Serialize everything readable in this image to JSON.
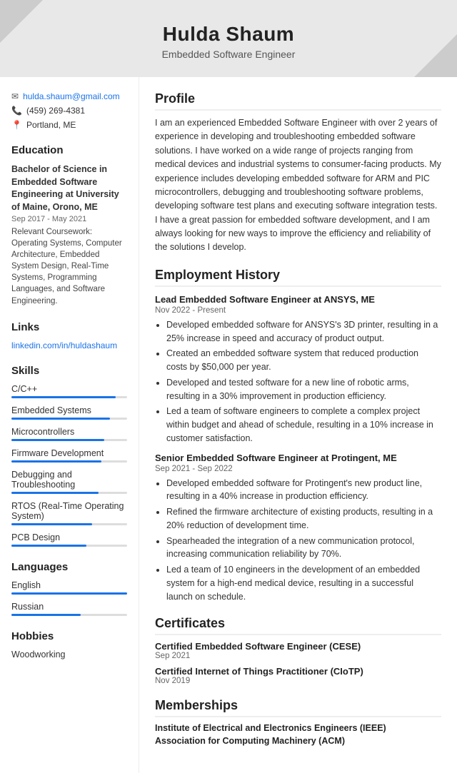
{
  "header": {
    "name": "Hulda Shaum",
    "title": "Embedded Software Engineer"
  },
  "sidebar": {
    "contact": {
      "email": "hulda.shaum@gmail.com",
      "phone": "(459) 269-4381",
      "location": "Portland, ME"
    },
    "education": {
      "section_title": "Education",
      "degree": "Bachelor of Science in Embedded Software Engineering at University of Maine, Orono, ME",
      "date": "Sep 2017 - May 2021",
      "coursework_label": "Relevant Coursework:",
      "coursework": "Operating Systems, Computer Architecture, Embedded System Design, Real-Time Systems, Programming Languages, and Software Engineering."
    },
    "links": {
      "section_title": "Links",
      "items": [
        {
          "label": "linkedin.com/in/huldashaum",
          "url": "#"
        }
      ]
    },
    "skills": {
      "section_title": "Skills",
      "items": [
        {
          "name": "C/C++",
          "percent": 90
        },
        {
          "name": "Embedded Systems",
          "percent": 85
        },
        {
          "name": "Microcontrollers",
          "percent": 80
        },
        {
          "name": "Firmware Development",
          "percent": 78
        },
        {
          "name": "Debugging and Troubleshooting",
          "percent": 75
        },
        {
          "name": "RTOS (Real-Time Operating System)",
          "percent": 70
        },
        {
          "name": "PCB Design",
          "percent": 65
        }
      ]
    },
    "languages": {
      "section_title": "Languages",
      "items": [
        {
          "name": "English",
          "percent": 100
        },
        {
          "name": "Russian",
          "percent": 60
        }
      ]
    },
    "hobbies": {
      "section_title": "Hobbies",
      "items": [
        {
          "name": "Woodworking"
        }
      ]
    }
  },
  "content": {
    "profile": {
      "section_title": "Profile",
      "text": "I am an experienced Embedded Software Engineer with over 2 years of experience in developing and troubleshooting embedded software solutions. I have worked on a wide range of projects ranging from medical devices and industrial systems to consumer-facing products. My experience includes developing embedded software for ARM and PIC microcontrollers, debugging and troubleshooting software problems, developing software test plans and executing software integration tests. I have a great passion for embedded software development, and I am always looking for new ways to improve the efficiency and reliability of the solutions I develop."
    },
    "employment": {
      "section_title": "Employment History",
      "jobs": [
        {
          "title": "Lead Embedded Software Engineer at ANSYS, ME",
          "date": "Nov 2022 - Present",
          "bullets": [
            "Developed embedded software for ANSYS's 3D printer, resulting in a 25% increase in speed and accuracy of product output.",
            "Created an embedded software system that reduced production costs by $50,000 per year.",
            "Developed and tested software for a new line of robotic arms, resulting in a 30% improvement in production efficiency.",
            "Led a team of software engineers to complete a complex project within budget and ahead of schedule, resulting in a 10% increase in customer satisfaction."
          ]
        },
        {
          "title": "Senior Embedded Software Engineer at Protingent, ME",
          "date": "Sep 2021 - Sep 2022",
          "bullets": [
            "Developed embedded software for Protingent's new product line, resulting in a 40% increase in production efficiency.",
            "Refined the firmware architecture of existing products, resulting in a 20% reduction of development time.",
            "Spearheaded the integration of a new communication protocol, increasing communication reliability by 70%.",
            "Led a team of 10 engineers in the development of an embedded system for a high-end medical device, resulting in a successful launch on schedule."
          ]
        }
      ]
    },
    "certificates": {
      "section_title": "Certificates",
      "items": [
        {
          "name": "Certified Embedded Software Engineer (CESE)",
          "date": "Sep 2021"
        },
        {
          "name": "Certified Internet of Things Practitioner (CIoTP)",
          "date": "Nov 2019"
        }
      ]
    },
    "memberships": {
      "section_title": "Memberships",
      "items": [
        {
          "name": "Institute of Electrical and Electronics Engineers (IEEE)"
        },
        {
          "name": "Association for Computing Machinery (ACM)"
        }
      ]
    }
  }
}
